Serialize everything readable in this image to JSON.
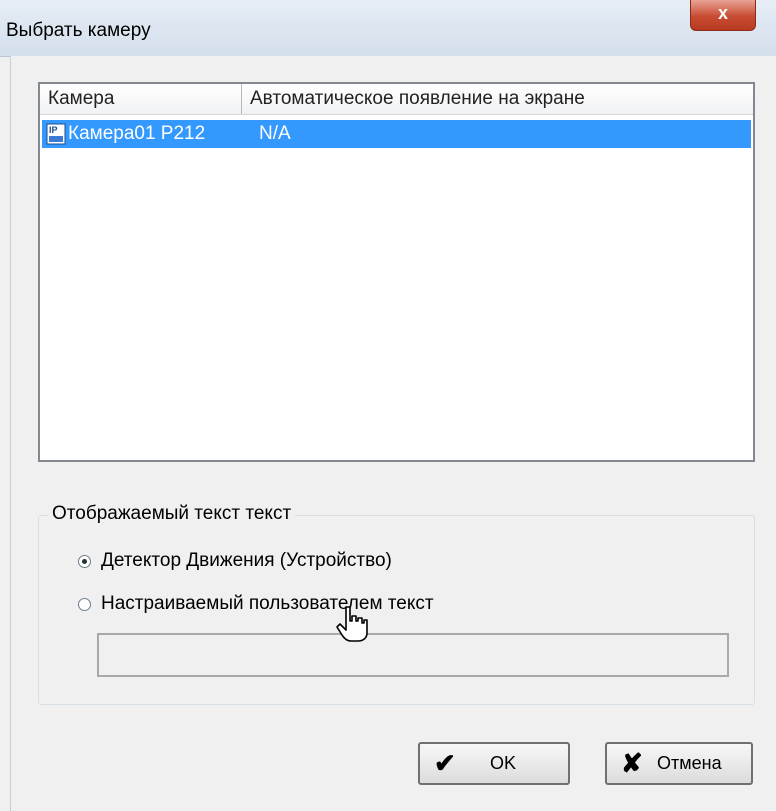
{
  "window": {
    "title": "Выбрать камеру",
    "close_glyph": "x"
  },
  "camera_list": {
    "columns": [
      "Камера",
      "Автоматическое появление на экране"
    ],
    "rows": [
      {
        "camera": "Камера01 P212",
        "auto_display": "N/A",
        "icon": "ip-camera-icon",
        "selected": true
      }
    ],
    "selection_color": "#3399ff"
  },
  "display_text": {
    "group_label": "Отображаемый текст текст",
    "options": [
      {
        "label": "Детектор Движения (Устройство)",
        "checked": true
      },
      {
        "label": "Настраиваемый пользователем текст",
        "checked": false
      }
    ],
    "custom_text_value": ""
  },
  "buttons": {
    "ok_label": "OK",
    "ok_glyph": "✔",
    "cancel_label": "Отмена",
    "cancel_glyph": "✘"
  }
}
